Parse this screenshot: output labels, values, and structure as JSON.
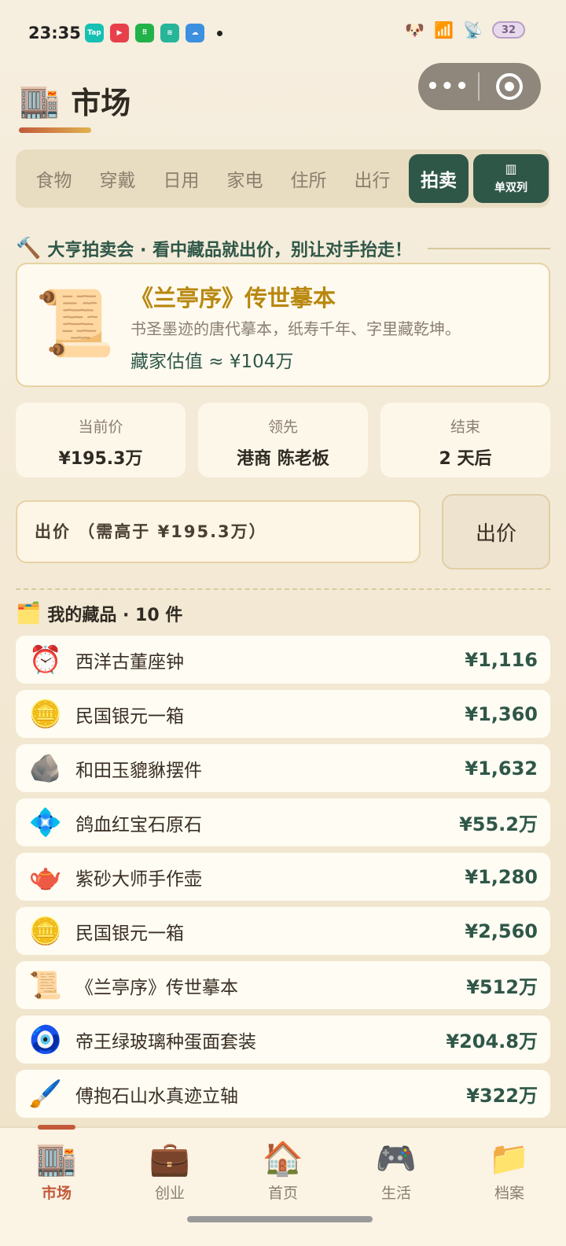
{
  "status_bar": {
    "time": "23:35",
    "apps": [
      {
        "label": "Tap",
        "color": "#16c1b3"
      },
      {
        "label": "▶",
        "color": "#e8404a"
      },
      {
        "label": "⠿",
        "color": "#22b24a"
      },
      {
        "label": "≋",
        "color": "#27b59a"
      },
      {
        "label": "☁",
        "color": "#3d8fe0"
      }
    ],
    "battery": "32"
  },
  "header": {
    "icon": "🏬",
    "title": "市场"
  },
  "tabs": [
    {
      "label": "食物"
    },
    {
      "label": "穿戴"
    },
    {
      "label": "日用"
    },
    {
      "label": "家电"
    },
    {
      "label": "住所"
    },
    {
      "label": "出行"
    },
    {
      "label": "拍卖"
    }
  ],
  "view_toggle": {
    "label": "单双列"
  },
  "auction": {
    "banner": "大亨拍卖会 · 看中藏品就出价，别让对手抬走！",
    "lot": {
      "icon": "📜",
      "title": "《兰亭序》传世摹本",
      "description": "书圣墨迹的唐代摹本，纸寿千年、字里藏乾坤。",
      "estimate": "藏家估值 ≈ ¥104万"
    },
    "stats": [
      {
        "label": "当前价",
        "value": "¥195.3万"
      },
      {
        "label": "领先",
        "value": "港商 陈老板"
      },
      {
        "label": "结束",
        "value": "2 天后"
      }
    ],
    "bid_placeholder": "出价 （需高于 ¥195.3万）",
    "bid_button": "出价"
  },
  "collection": {
    "icon": "🗂️",
    "title": "我的藏品 · 10 件",
    "items": [
      {
        "icon": "⏰",
        "name": "西洋古董座钟",
        "price": "¥1,116"
      },
      {
        "icon": "🪙",
        "name": "民国银元一箱",
        "price": "¥1,360"
      },
      {
        "icon": "🪨",
        "name": "和田玉貔貅摆件",
        "price": "¥1,632"
      },
      {
        "icon": "💠",
        "name": "鸽血红宝石原石",
        "price": "¥55.2万"
      },
      {
        "icon": "🫖",
        "name": "紫砂大师手作壶",
        "price": "¥1,280"
      },
      {
        "icon": "🪙",
        "name": "民国银元一箱",
        "price": "¥2,560"
      },
      {
        "icon": "📜",
        "name": "《兰亭序》传世摹本",
        "price": "¥512万"
      },
      {
        "icon": "🧿",
        "name": "帝王绿玻璃种蛋面套装",
        "price": "¥204.8万"
      },
      {
        "icon": "🖌️",
        "name": "傅抱石山水真迹立轴",
        "price": "¥322万"
      }
    ]
  },
  "nav": [
    {
      "icon": "🏬",
      "label": "市场",
      "active": true
    },
    {
      "icon": "💼",
      "label": "创业"
    },
    {
      "icon": "🏠",
      "label": "首页"
    },
    {
      "icon": "🎮",
      "label": "生活"
    },
    {
      "icon": "📁",
      "label": "档案"
    }
  ]
}
